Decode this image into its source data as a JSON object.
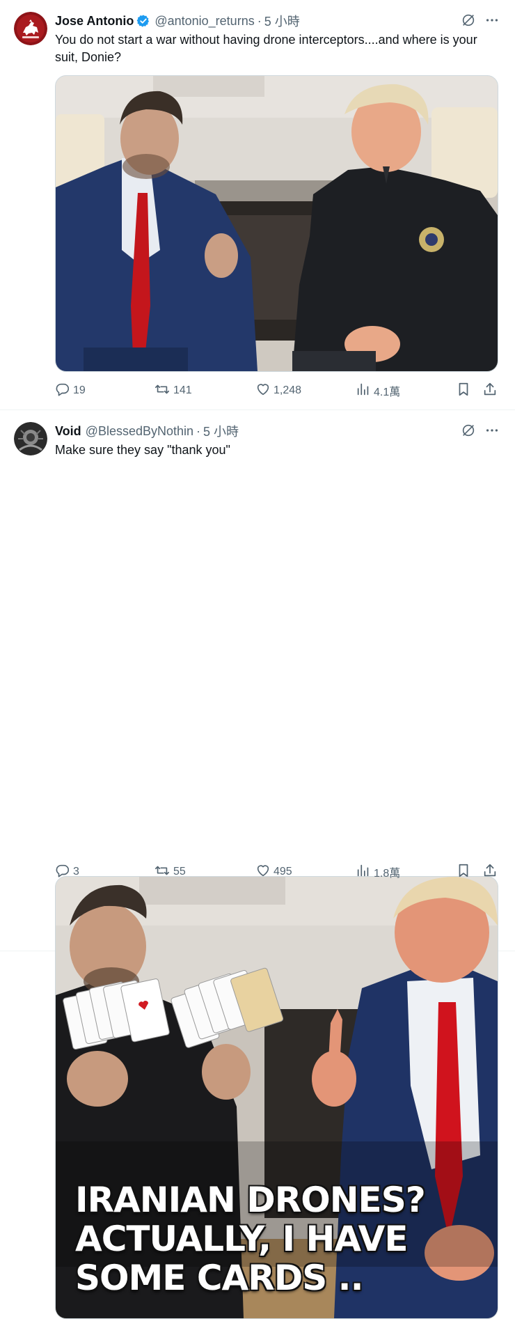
{
  "posts": [
    {
      "display_name": "Jose Antonio",
      "verified": true,
      "handle": "@antonio_returns",
      "separator": "·",
      "time": "5 小時",
      "text": "You do not start a war without having drone interceptors....and where is your suit, Donie?",
      "image_caption_lines": [],
      "stats": {
        "replies": "19",
        "retweets": "141",
        "likes": "1,248",
        "views": "4.1萬"
      }
    },
    {
      "display_name": "Void",
      "verified": false,
      "handle": "@BlessedByNothin",
      "separator": "·",
      "time": "5 小時",
      "text": "Make sure they say \"thank you\"",
      "image_caption_lines": [
        "IRANIAN DRONES?",
        "ACTUALLY, I HAVE",
        "SOME CARDS .."
      ],
      "stats": {
        "replies": "3",
        "retweets": "55",
        "likes": "495",
        "views": "1.8萬"
      }
    }
  ],
  "icons": [
    "verified-badge-icon",
    "grok-icon",
    "more-icon",
    "reply-icon",
    "retweet-icon",
    "like-icon",
    "views-icon",
    "bookmark-icon",
    "share-icon"
  ],
  "colors": {
    "verified_blue": "#1d9bf0",
    "icon_gray": "#536471",
    "text_dark": "#0f1419",
    "border": "#cfd9de"
  }
}
